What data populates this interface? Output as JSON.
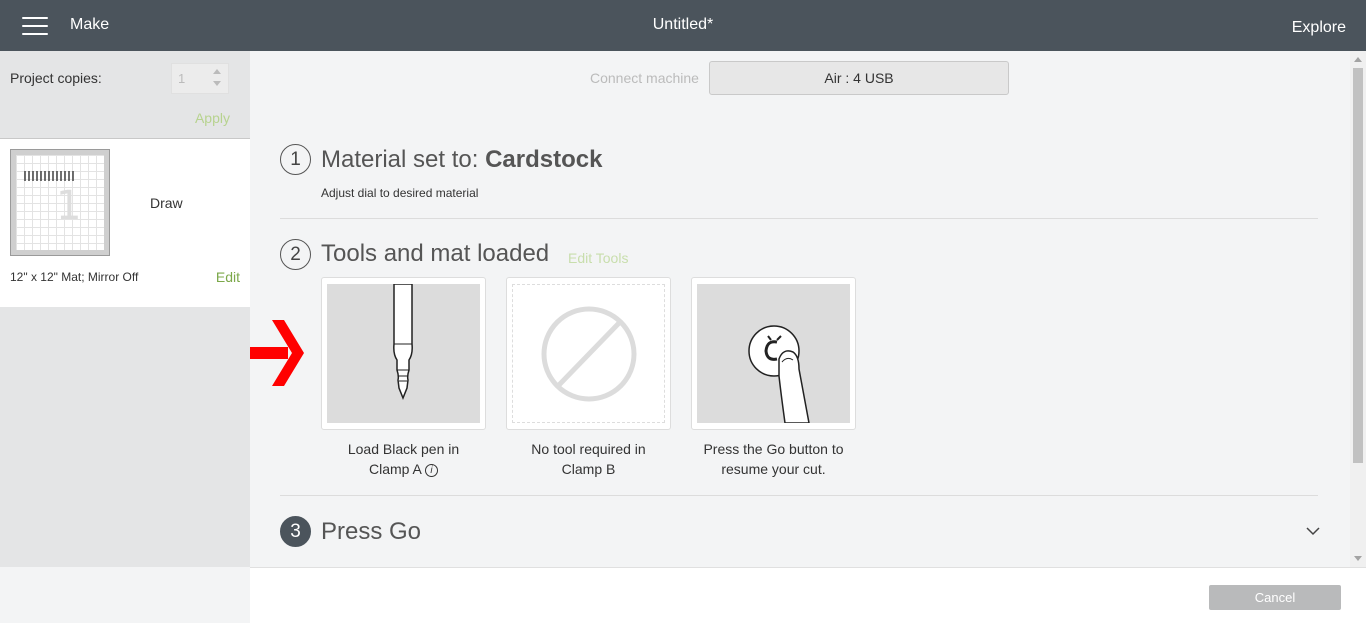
{
  "header": {
    "menu_icon": "hamburger-menu-icon",
    "make_label": "Make",
    "document_title": "Untitled*",
    "explore_label": "Explore"
  },
  "sidebar": {
    "project_copies_label": "Project copies:",
    "project_copies_value": "1",
    "apply_label": "Apply",
    "mat": {
      "operation_label": "Draw",
      "mat_number": "1",
      "info": "12\" x 12\" Mat; Mirror Off",
      "edit_label": "Edit"
    }
  },
  "connection": {
    "label": "Connect machine",
    "machine": "Air : 4 USB"
  },
  "steps": [
    {
      "number": "1",
      "title_prefix": "Material set to: ",
      "title_bold": "Cardstock",
      "subtext": "Adjust dial to desired material"
    },
    {
      "number": "2",
      "title": "Tools and mat loaded",
      "edit_tools_label": "Edit Tools",
      "tools": [
        {
          "icon": "pen-icon",
          "caption_line1": "Load Black pen in",
          "caption_line2": "Clamp A",
          "info_icon": "info-icon"
        },
        {
          "icon": "no-tool-icon",
          "caption_line1": "No tool required in",
          "caption_line2": "Clamp B"
        },
        {
          "icon": "press-go-button-icon",
          "caption_line1": "Press the Go button to",
          "caption_line2": "resume your cut."
        }
      ]
    },
    {
      "number": "3",
      "title": "Press Go"
    }
  ],
  "footer": {
    "cancel_label": "Cancel"
  },
  "colors": {
    "header_bg": "#4b545c",
    "accent_green": "#7ca84a",
    "arrow_red": "#ff0000"
  }
}
